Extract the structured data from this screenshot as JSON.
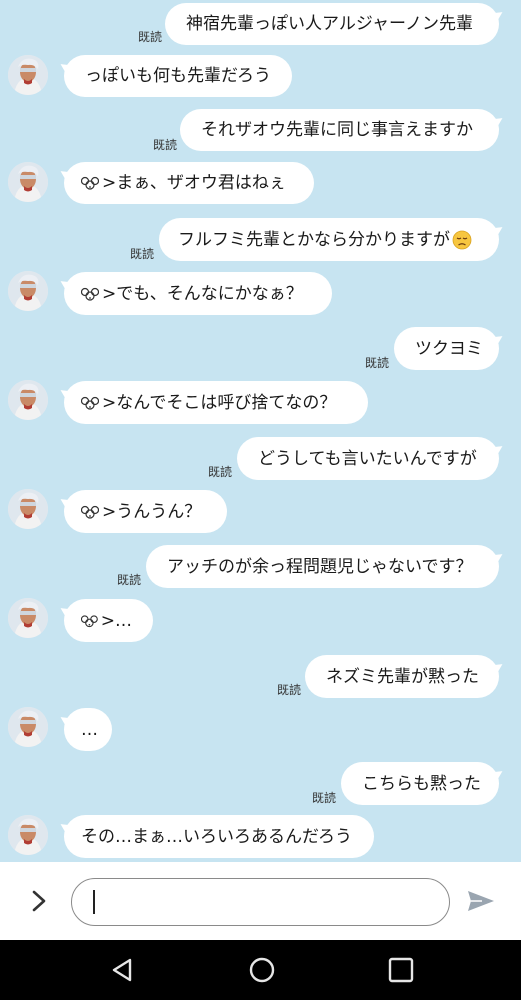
{
  "chat": {
    "read_label": "既読",
    "messages": [
      {
        "dir": "out",
        "text": "神宿先輩っぽい人アルジャーノン先輩"
      },
      {
        "dir": "in",
        "text": "っぽいも何も先輩だろう"
      },
      {
        "dir": "out",
        "text": "それザオウ先輩に同じ事言えますか"
      },
      {
        "dir": "in",
        "text": ">まぁ、ザオウ君はねぇ",
        "sticker": true
      },
      {
        "dir": "out",
        "text": "フルフミ先輩とかなら分かりますが",
        "emoji": "disappointed-face-emoji"
      },
      {
        "dir": "in",
        "text": ">でも、そんなにかなぁ？",
        "sticker": true
      },
      {
        "dir": "out",
        "text": "ツクヨミ"
      },
      {
        "dir": "in",
        "text": ">なんでそこは呼び捨てなの？",
        "sticker": true
      },
      {
        "dir": "out",
        "text": "どうしても言いたいんですが"
      },
      {
        "dir": "in",
        "text": ">うんうん？",
        "sticker": true
      },
      {
        "dir": "out",
        "text": "アッチのが余っ程問題児じゃないです？"
      },
      {
        "dir": "in",
        "text": ">…",
        "sticker": true
      },
      {
        "dir": "out",
        "text": "ネズミ先輩が黙った"
      },
      {
        "dir": "in",
        "text": "…"
      },
      {
        "dir": "out",
        "text": "こちらも黙った"
      },
      {
        "dir": "in",
        "text": "その…まぁ…いろいろあるんだろう"
      }
    ]
  },
  "input": {
    "value": "",
    "expand_icon": "chevron-right-icon",
    "send_icon": "send-icon"
  },
  "nav": {
    "back_icon": "back-triangle-icon",
    "home_icon": "home-circle-icon",
    "recents_icon": "recents-square-icon"
  }
}
